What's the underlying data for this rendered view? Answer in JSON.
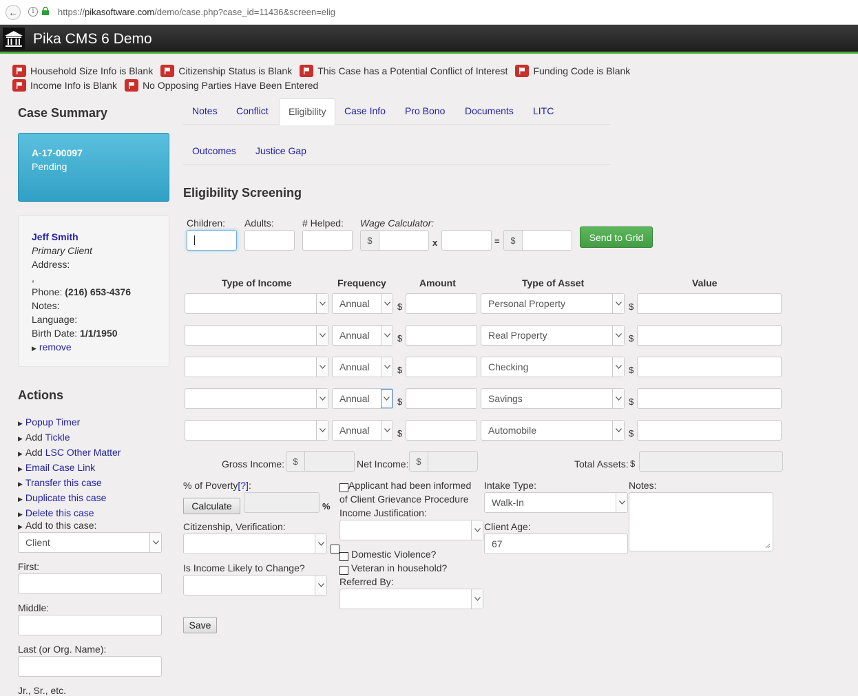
{
  "browser": {
    "url_prefix": "https://",
    "url_domain": "pikasoftware.com",
    "url_path": "/demo/case.php?case_id=11436&screen=elig"
  },
  "app": {
    "title": "Pika CMS 6 Demo"
  },
  "flags": [
    "Household Size Info is Blank",
    "Citizenship Status is Blank",
    "This Case has a Potential Conflict of Interest",
    "Funding Code is Blank",
    "Income Info is Blank",
    "No Opposing Parties Have Been Entered"
  ],
  "sidebar": {
    "summary_heading": "Case Summary",
    "case_number": "A-17-00097",
    "case_status": "Pending",
    "client": {
      "name": "Jeff Smith",
      "role": "Primary Client",
      "address_label": "Address:",
      "address_value": ",",
      "phone_label": "Phone:",
      "phone": "(216) 653-4376",
      "notes_label": "Notes:",
      "language_label": "Language:",
      "birth_label": "Birth Date:",
      "birth_date": "1/1/1950",
      "remove_label": "remove"
    },
    "actions_heading": "Actions",
    "actions": [
      {
        "prefix": "",
        "link": "Popup Timer"
      },
      {
        "prefix": "Add ",
        "link": "Tickle"
      },
      {
        "prefix": "Add ",
        "link": "LSC Other Matter"
      },
      {
        "prefix": "",
        "link": "Email Case Link"
      },
      {
        "prefix": "",
        "link": "Transfer this case"
      },
      {
        "prefix": "",
        "link": "Duplicate this case"
      },
      {
        "prefix": "",
        "link": "Delete this case"
      }
    ],
    "add_to_case_label": "Add to this case:",
    "add_to_case_value": "Client",
    "first_label": "First:",
    "middle_label": "Middle:",
    "last_label": "Last (or Org. Name):",
    "suffix_label": "Jr., Sr., etc."
  },
  "tabs": {
    "row1": [
      "Notes",
      "Conflict",
      "Eligibility",
      "Case Info",
      "Pro Bono",
      "Documents",
      "LITC"
    ],
    "row2": [
      "Outcomes",
      "Justice Gap"
    ],
    "active": "Eligibility"
  },
  "eligibility": {
    "heading": "Eligibility Screening",
    "children_label": "Children:",
    "adults_label": "Adults:",
    "helped_label": "# Helped:",
    "wage_label": "Wage Calculator:",
    "currency": "$",
    "times": "x",
    "equals": "=",
    "send_button": "Send to Grid",
    "columns": {
      "income_type": "Type of Income",
      "frequency": "Frequency",
      "amount": "Amount",
      "asset_type": "Type of Asset",
      "value": "Value"
    },
    "rows": [
      {
        "income_type": "",
        "frequency": "Annual",
        "amount": "",
        "asset_type": "Personal Property",
        "value": ""
      },
      {
        "income_type": "",
        "frequency": "Annual",
        "amount": "",
        "asset_type": "Real Property",
        "value": ""
      },
      {
        "income_type": "",
        "frequency": "Annual",
        "amount": "",
        "asset_type": "Checking",
        "value": ""
      },
      {
        "income_type": "",
        "frequency": "Annual",
        "amount": "",
        "asset_type": "Savings",
        "value": ""
      },
      {
        "income_type": "",
        "frequency": "Annual",
        "amount": "",
        "asset_type": "Automobile",
        "value": ""
      }
    ],
    "gross_income_label": "Gross Income:",
    "net_income_label": "Net Income:",
    "total_assets_label": "Total Assets:",
    "poverty_label": "% of Poverty",
    "poverty_help": "[?]",
    "poverty_suffix": ":",
    "calculate_button": "Calculate",
    "percent": "%",
    "citizenship_label": "Citizenship, Verification:",
    "income_change_label": "Is Income Likely to Change?",
    "grievance_label_1": "Applicant had been informed",
    "grievance_label_2": "of Client Grievance Procedure",
    "income_justification_label": "Income Justification:",
    "domestic_violence_label": "Domestic Violence?",
    "veteran_label": "Veteran in household?",
    "referred_by_label": "Referred By:",
    "intake_type_label": "Intake Type:",
    "intake_type_value": "Walk-In",
    "client_age_label": "Client Age:",
    "client_age_value": "67",
    "notes_label": "Notes:",
    "save_button": "Save"
  }
}
